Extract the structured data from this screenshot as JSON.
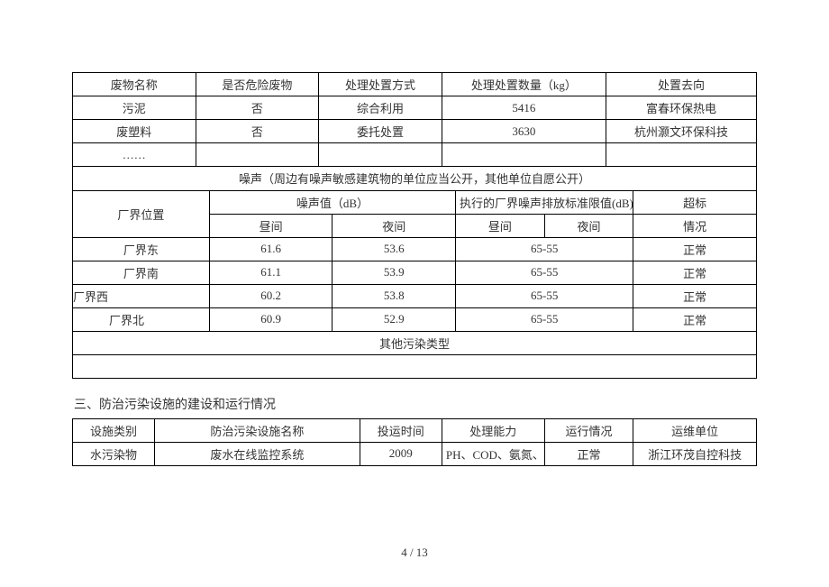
{
  "waste_table": {
    "headers": [
      "废物名称",
      "是否危险废物",
      "处理处置方式",
      "处理处置数量（kg）",
      "处置去向"
    ],
    "rows": [
      {
        "name": "污泥",
        "hazard": "否",
        "method": "综合利用",
        "qty": "5416",
        "dest": "富春环保热电"
      },
      {
        "name": "废塑料",
        "hazard": "否",
        "method": "委托处置",
        "qty": "3630",
        "dest": "杭州灏文环保科技"
      },
      {
        "name": "……",
        "hazard": "",
        "method": "",
        "qty": "",
        "dest": ""
      }
    ]
  },
  "noise_section": {
    "banner": "噪声（周边有噪声敏感建筑物的单位应当公开，其他单位自愿公开）",
    "header": {
      "pos": "厂界位置",
      "val": "噪声值（dB）",
      "limit": "执行的厂界噪声排放标准限值(dB)",
      "exceed": "超标",
      "day": "昼间",
      "night": "夜间",
      "day2": "昼间",
      "night2": "夜间",
      "status": "情况"
    },
    "rows": [
      {
        "pos": "厂界东",
        "day": "61.6",
        "night": "53.6",
        "limit": "65-55",
        "status": "正常"
      },
      {
        "pos": "厂界南",
        "day": "61.1",
        "night": "53.9",
        "limit": "65-55",
        "status": "正常"
      },
      {
        "pos": "厂界西",
        "day": "60.2",
        "night": "53.8",
        "limit": "65-55",
        "status": "正常"
      },
      {
        "pos": "厂界北",
        "day": "60.9",
        "night": "52.9",
        "limit": "65-55",
        "status": "正常"
      }
    ],
    "other_type": "其他污染类型",
    "blank": ""
  },
  "section3_title": "三、防治污染设施的建设和运行情况",
  "facility_table": {
    "headers": [
      "设施类别",
      "防治污染设施名称",
      "投运时间",
      "处理能力",
      "运行情况",
      "运维单位"
    ],
    "rows": [
      {
        "cat": "水污染物",
        "name": "废水在线监控系统",
        "year": "2009",
        "cap": "PH、COD、氨氮、",
        "run": "正常",
        "maint": "浙江环茂自控科技"
      }
    ]
  },
  "page_number": "4  /  13"
}
